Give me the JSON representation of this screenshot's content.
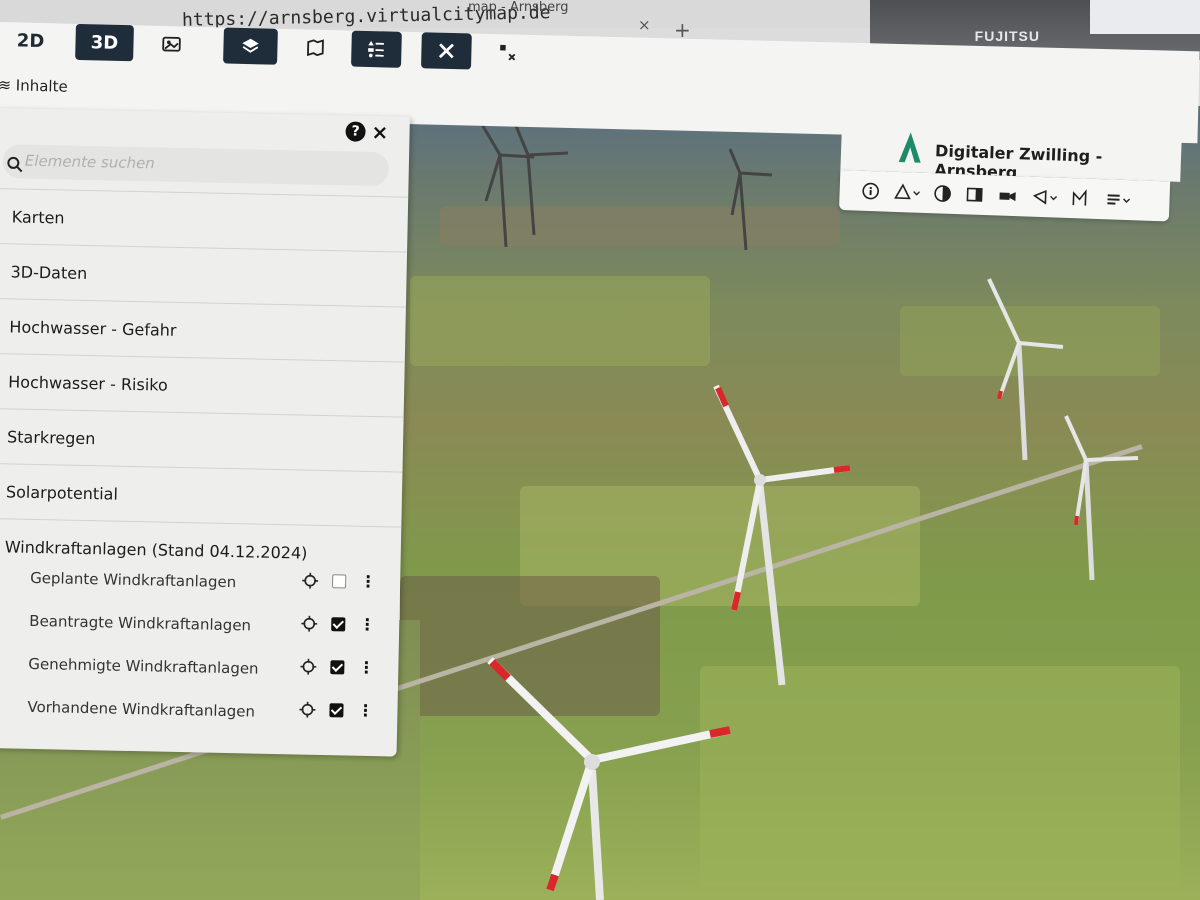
{
  "browser": {
    "url": "https://arnsberg.virtualcitymap.de",
    "tab_title": "map - Arnsberg",
    "close_glyph": "×",
    "new_tab_glyph": "+"
  },
  "monitor_brand": "FUJITSU",
  "toolbar": {
    "btn_2d": "2D",
    "btn_3d": "3D",
    "icons": [
      "image-icon",
      "layers-icon",
      "map-book-icon",
      "legend-list-icon",
      "tools-icon",
      "compare-icon"
    ],
    "inhalte": "Inhalte"
  },
  "panel": {
    "search_placeholder": "Elemente suchen",
    "help_glyph": "?",
    "close_glyph": "×",
    "categories": [
      "Karten",
      "3D-Daten",
      "Hochwasser - Gefahr",
      "Hochwasser - Risiko",
      "Starkregen",
      "Solarpotential",
      "Windkraftanlagen (Stand 04.12.2024)"
    ],
    "layers": [
      {
        "label": "Geplante Windkraftanlagen",
        "checked": false
      },
      {
        "label": "Beantragte Windkraftanlagen",
        "checked": true
      },
      {
        "label": "Genehmigte Windkraftanlagen",
        "checked": true
      },
      {
        "label": "Vorhandene Windkraftanlagen",
        "checked": true
      }
    ],
    "kebab_glyph": "⋮"
  },
  "header": {
    "logo_letter": "A",
    "title": "Digitaler Zwilling - Arnsberg",
    "tools": [
      "info-icon",
      "measure-icon",
      "shadow-icon",
      "split-view-icon",
      "viewpoint-icon",
      "flight-icon",
      "profile-icon",
      "more-icon"
    ]
  },
  "colors": {
    "accent_dark": "#1f2d3a",
    "logo_green": "#1d8a6a",
    "turbine_red": "#d8282a"
  }
}
